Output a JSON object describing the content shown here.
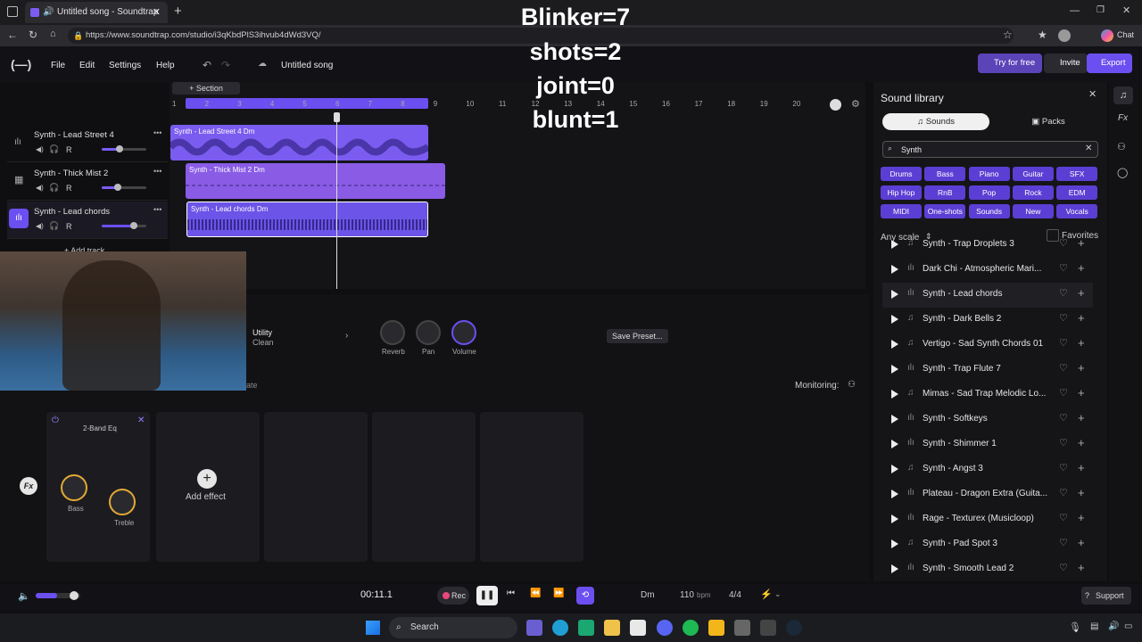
{
  "browser": {
    "tab_title": "Untitled song - Soundtrap",
    "url": "https://www.soundtrap.com/studio/i3qKbdPlS3ihvub4dWd3VQ/",
    "profile": "Chat"
  },
  "app": {
    "menu": [
      "File",
      "Edit",
      "Settings",
      "Help"
    ],
    "song_title": "Untitled song",
    "try_free": "Try for free",
    "invite": "Invite",
    "export": "Export"
  },
  "overlay": {
    "line1": "Blinker=7",
    "line2": "shots=2",
    "line3": "joint=0",
    "line4": "blunt=1"
  },
  "timeline": {
    "section_label": "+ Section",
    "bars": [
      "1",
      "2",
      "3",
      "4",
      "5",
      "6",
      "7",
      "8",
      "9",
      "10",
      "11",
      "12",
      "13",
      "14",
      "15",
      "16",
      "17",
      "18",
      "19",
      "20"
    ],
    "add_track": "+ Add track"
  },
  "tracks": [
    {
      "name": "Synth - Lead Street 4",
      "clip": "Synth - Lead Street 4 Dm",
      "color": "#7b5cf0",
      "volume": 0.5
    },
    {
      "name": "Synth - Thick Mist 2",
      "clip": "Synth - Thick Mist 2 Dm",
      "color": "#8a5ce6",
      "volume": 0.45
    },
    {
      "name": "Synth - Lead chords",
      "clip": "Synth - Lead chords Dm",
      "color": "#6c54e8",
      "volume": 0.7
    }
  ],
  "track_tools": "R",
  "instrument": {
    "name": "Utility",
    "preset": "Clean",
    "knobs": [
      "Reverb",
      "Pan",
      "Volume"
    ],
    "save_preset": "Save Preset..."
  },
  "effects": {
    "monitoring_label": "Monitoring:",
    "partial_label": "ate",
    "eq_name": "2-Band Eq",
    "eq_knobs": [
      "Bass",
      "Treble"
    ],
    "add_effect": "Add effect"
  },
  "library": {
    "title": "Sound library",
    "tab_sounds": "Sounds",
    "tab_packs": "Packs",
    "search_value": "Synth",
    "categories": [
      "Drums",
      "Bass",
      "Piano",
      "Guitar",
      "SFX",
      "Hip Hop",
      "RnB",
      "Pop",
      "Rock",
      "EDM",
      "MIDI",
      "One-shots",
      "Sounds",
      "New",
      "Vocals"
    ],
    "scale_label": "Any scale",
    "favorites_label": "Favorites",
    "items": [
      "Synth - Trap Droplets 3",
      "Dark Chi - Atmospheric Mari...",
      "Synth - Lead chords",
      "Synth - Dark Bells 2",
      "Vertigo - Sad Synth Chords 01",
      "Synth - Trap Flute 7",
      "Mimas - Sad Trap Melodic Lo...",
      "Synth - Softkeys",
      "Synth - Shimmer 1",
      "Synth - Angst 3",
      "Plateau - Dragon Extra (Guita...",
      "Rage - Texturex (Musicloop)",
      "Synth - Pad Spot 3",
      "Synth - Smooth Lead 2"
    ]
  },
  "transport": {
    "time": "00:11.1",
    "rec": "Rec",
    "key": "Dm",
    "tempo": "110",
    "bpm": "bpm",
    "meter": "4/4",
    "support": "Support"
  },
  "taskbar": {
    "search": "Search"
  },
  "colors": {
    "accent": "#7b5cf0",
    "clip_purple": "#7b5cf0",
    "knob_orange": "#e3a935"
  }
}
